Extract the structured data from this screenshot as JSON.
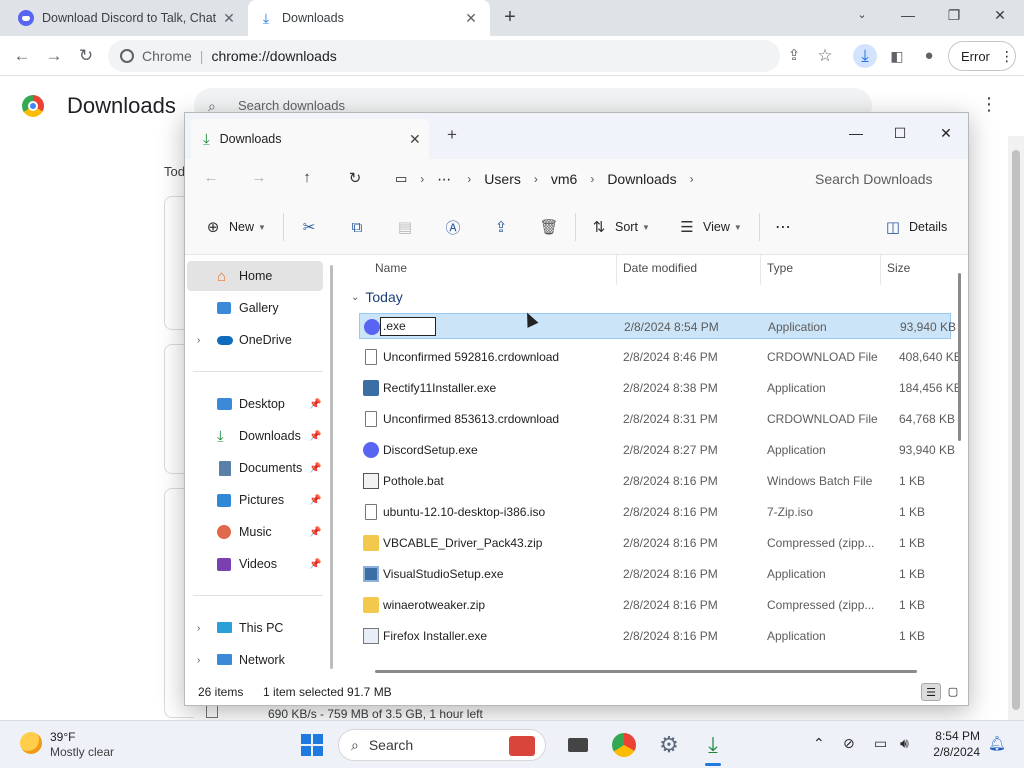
{
  "browser": {
    "tabs": [
      {
        "title": "Download Discord to Talk, Chat",
        "icon": "discord-icon"
      },
      {
        "title": "Downloads",
        "icon": "download-icon"
      }
    ],
    "address": {
      "site": "Chrome",
      "url": "chrome://downloads"
    },
    "error_label": "Error"
  },
  "downloads_page": {
    "title": "Downloads",
    "search_placeholder": "Search downloads",
    "section": "Tod",
    "status": "690 KB/s - 759 MB of 3.5 GB, 1 hour left"
  },
  "explorer": {
    "tab_title": "Downloads",
    "breadcrumb": [
      "Users",
      "vm6",
      "Downloads"
    ],
    "search_placeholder": "Search Downloads",
    "commands": {
      "new": "New",
      "sort": "Sort",
      "view": "View",
      "details": "Details"
    },
    "nav": [
      {
        "label": "Home",
        "icon": "home-icon",
        "selected": true
      },
      {
        "label": "Gallery",
        "icon": "gallery-icon"
      },
      {
        "label": "OneDrive",
        "icon": "onedrive-icon"
      },
      {
        "label": "Desktop",
        "icon": "desktop-icon",
        "pinned": true
      },
      {
        "label": "Downloads",
        "icon": "download-icon",
        "pinned": true
      },
      {
        "label": "Documents",
        "icon": "documents-icon",
        "pinned": true
      },
      {
        "label": "Pictures",
        "icon": "pictures-icon",
        "pinned": true
      },
      {
        "label": "Music",
        "icon": "music-icon",
        "pinned": true
      },
      {
        "label": "Videos",
        "icon": "videos-icon",
        "pinned": true
      },
      {
        "label": "This PC",
        "icon": "pc-icon"
      },
      {
        "label": "Network",
        "icon": "network-icon"
      }
    ],
    "columns": [
      "Name",
      "Date modified",
      "Type",
      "Size"
    ],
    "group": "Today",
    "rename_value": ".exe",
    "files": [
      {
        "name": ".exe",
        "date": "2/8/2024 8:54 PM",
        "type": "Application",
        "size": "93,940 KB",
        "icon": "discord-icon",
        "selected": true
      },
      {
        "name": "Unconfirmed 592816.crdownload",
        "date": "2/8/2024 8:46 PM",
        "type": "CRDOWNLOAD File",
        "size": "408,640 KB",
        "icon": "file-icon"
      },
      {
        "name": "Rectify11Installer.exe",
        "date": "2/8/2024 8:38 PM",
        "type": "Application",
        "size": "184,456 KB",
        "icon": "exe-icon"
      },
      {
        "name": "Unconfirmed 853613.crdownload",
        "date": "2/8/2024 8:31 PM",
        "type": "CRDOWNLOAD File",
        "size": "64,768 KB",
        "icon": "file-icon"
      },
      {
        "name": "DiscordSetup.exe",
        "date": "2/8/2024 8:27 PM",
        "type": "Application",
        "size": "93,940 KB",
        "icon": "discord-icon"
      },
      {
        "name": "Pothole.bat",
        "date": "2/8/2024 8:16 PM",
        "type": "Windows Batch File",
        "size": "1 KB",
        "icon": "bat-icon"
      },
      {
        "name": "ubuntu-12.10-desktop-i386.iso",
        "date": "2/8/2024 8:16 PM",
        "type": "7-Zip.iso",
        "size": "1 KB",
        "icon": "file-icon"
      },
      {
        "name": "VBCABLE_Driver_Pack43.zip",
        "date": "2/8/2024 8:16 PM",
        "type": "Compressed (zipp...",
        "size": "1 KB",
        "icon": "zip-icon"
      },
      {
        "name": "VisualStudioSetup.exe",
        "date": "2/8/2024 8:16 PM",
        "type": "Application",
        "size": "1 KB",
        "icon": "vs-icon"
      },
      {
        "name": "winaerotweaker.zip",
        "date": "2/8/2024 8:16 PM",
        "type": "Compressed (zipp...",
        "size": "1 KB",
        "icon": "zip-icon"
      },
      {
        "name": "Firefox Installer.exe",
        "date": "2/8/2024 8:16 PM",
        "type": "Application",
        "size": "1 KB",
        "icon": "firefox-icon"
      }
    ],
    "status": {
      "count": "26 items",
      "selection": "1 item selected",
      "size": "91.7 MB"
    }
  },
  "taskbar": {
    "weather": {
      "temp": "39°F",
      "desc": "Mostly clear"
    },
    "search_label": "Search",
    "time": "8:54 PM",
    "date": "2/8/2024"
  }
}
